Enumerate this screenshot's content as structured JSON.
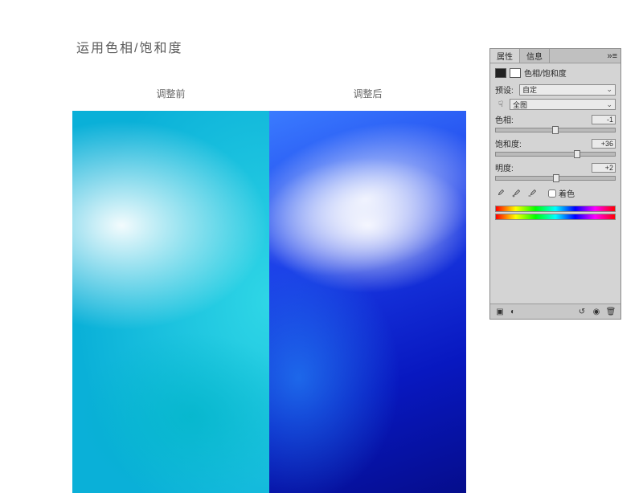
{
  "title": "运用色相/饱和度",
  "labels": {
    "before": "调整前",
    "after": "调整后"
  },
  "panel": {
    "tabs": {
      "properties": "属性",
      "info": "信息"
    },
    "adjustment_name": "色相/饱和度",
    "preset_label": "预设:",
    "preset_value": "自定",
    "range_value": "全图",
    "sliders": {
      "hue": {
        "label": "色相:",
        "value": "-1",
        "pos": 50
      },
      "saturation": {
        "label": "饱和度:",
        "value": "+36",
        "pos": 68
      },
      "lightness": {
        "label": "明度:",
        "value": "+2",
        "pos": 51
      }
    },
    "colorize_label": "着色"
  }
}
